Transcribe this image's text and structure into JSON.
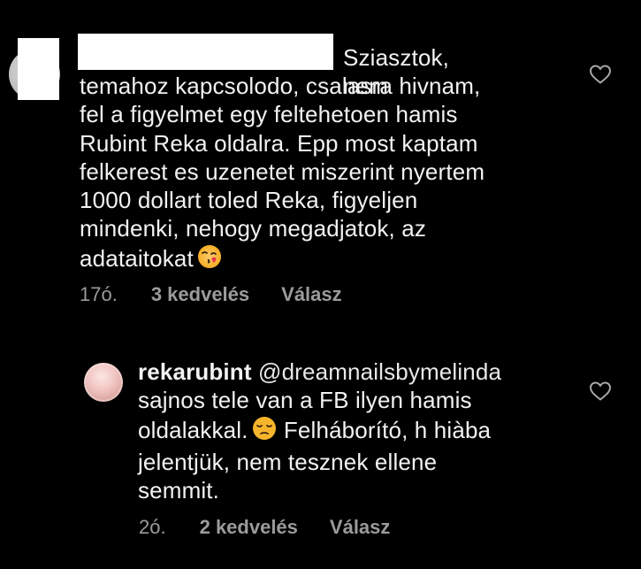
{
  "comments": [
    {
      "first_line": "Sziasztok, nem",
      "text": "temahoz kapcsolodo, csalasra hivnam,\nfel a figyelmet egy feltehetoen hamis\nRubint Reka oldalra. Epp most kaptam\nfelkerest es uzenetet miszerint nyertem\n1000 dollart toled Reka, figyeljen\nmindenki, nehogy megadjatok, az\nadataitokat",
      "emoji": "kissing-heart-emoji",
      "time": "17ó.",
      "likes": "3 kedvelés",
      "reply": "Válasz"
    },
    {
      "username": "rekarubint",
      "mention": "@dreamnailsbymelinda",
      "text_line1": "sajnos tele van a FB ilyen hamis",
      "text_line2a": "oldalakkal.",
      "emoji": "pensive-face-emoji",
      "text_line2b": " Felháborító, h hiàba\njelentjük, nem tesznek ellene\nsemmit.",
      "time": "2ó.",
      "likes": "2 kedvelés",
      "reply": "Válasz"
    }
  ],
  "colors": {
    "background": "#000000",
    "text": "#f2f2f2",
    "meta": "#9b9b9b"
  },
  "icons": [
    "heart-outline-icon",
    "heart-outline-icon"
  ]
}
